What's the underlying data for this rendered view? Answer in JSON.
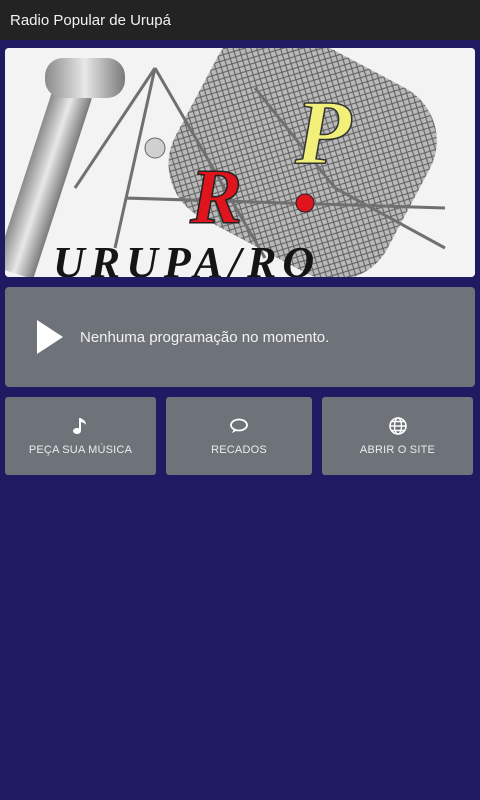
{
  "appbar": {
    "title": "Radio Popular de Urupá"
  },
  "banner": {
    "logo_letters": "R.P",
    "location": "URUPA/RO"
  },
  "player": {
    "status_text": "Nenhuma programação no momento."
  },
  "actions": [
    {
      "icon": "music-note-icon",
      "label": "PEÇA SUA MÚSICA"
    },
    {
      "icon": "speech-bubble-icon",
      "label": "RECADOS"
    },
    {
      "icon": "globe-icon",
      "label": "ABRIR O SITE"
    }
  ],
  "colors": {
    "background": "#201a63",
    "appbar": "#232323",
    "card": "#6e737a",
    "logo_red": "#e0141c",
    "logo_yellow": "#f3f07a"
  }
}
